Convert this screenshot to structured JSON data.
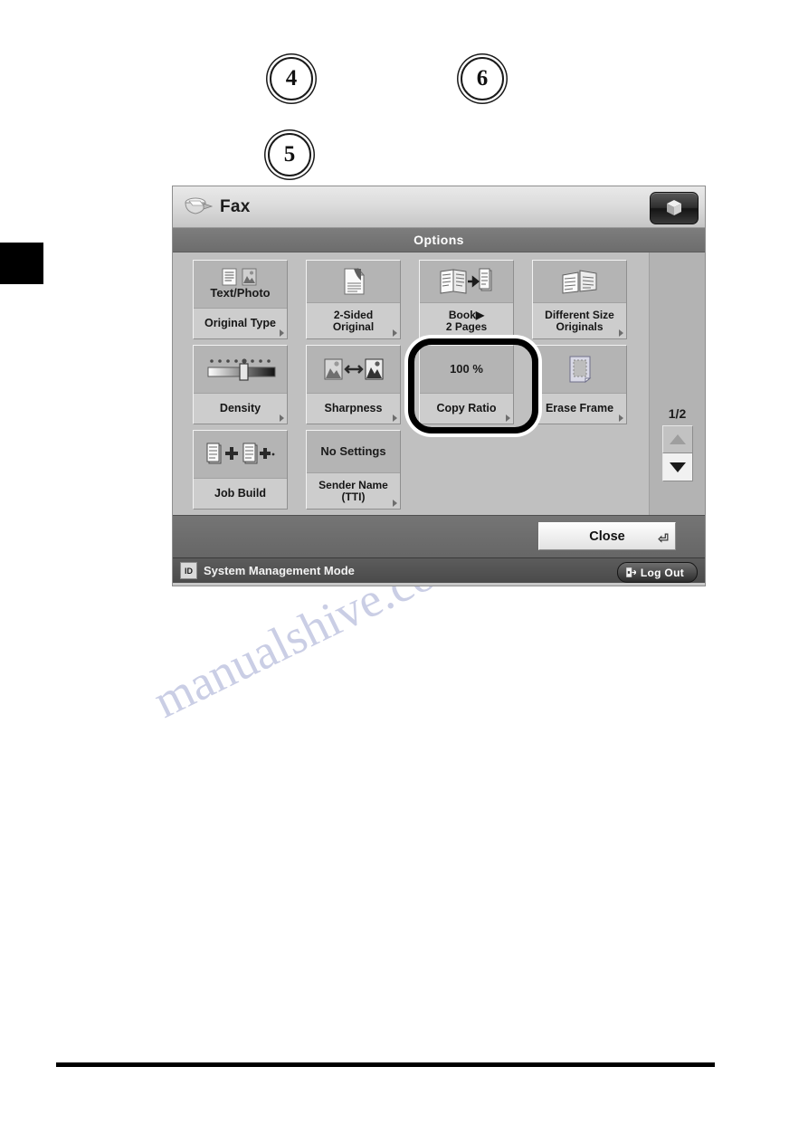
{
  "callouts": [
    {
      "id": "step4",
      "label": "4"
    },
    {
      "id": "step5",
      "label": "5"
    },
    {
      "id": "step6",
      "label": "6"
    }
  ],
  "watermark": {
    "line1": "manualshive.com",
    "line2": "manualshive.com"
  },
  "panel": {
    "titlebar": {
      "title": "Fax",
      "fax_icon": "fax-machine-icon",
      "cube_button_icon": "cube-icon"
    },
    "options_header": "Options",
    "buttons": [
      {
        "name": "original-type",
        "icon": "text-photo-icon",
        "value": "Text/Photo",
        "label": "Original Type",
        "has_arrow": true,
        "value_is_text": true
      },
      {
        "name": "two-sided-original",
        "icon": "folded-page-icon",
        "value": "",
        "label": "2-Sided\nOriginal",
        "has_arrow": true,
        "value_is_text": false
      },
      {
        "name": "book-to-two-pages",
        "icon": "book-to-pages-icon",
        "value": "",
        "label": "Book▶\n2 Pages",
        "has_arrow": false,
        "value_is_text": false
      },
      {
        "name": "different-size-originals",
        "icon": "different-size-icon",
        "value": "",
        "label": "Different Size\nOriginals",
        "has_arrow": true,
        "value_is_text": false
      },
      {
        "name": "density",
        "icon": "density-slider-icon",
        "value": "",
        "label": "Density",
        "has_arrow": true,
        "value_is_text": false
      },
      {
        "name": "sharpness",
        "icon": "sharpness-icon",
        "value": "",
        "label": "Sharpness",
        "has_arrow": true,
        "value_is_text": false
      },
      {
        "name": "copy-ratio",
        "icon": "",
        "value": "100 %",
        "label": "Copy Ratio",
        "has_arrow": true,
        "value_is_text": true,
        "highlighted": true
      },
      {
        "name": "erase-frame",
        "icon": "erase-frame-icon",
        "value": "",
        "label": "Erase Frame",
        "has_arrow": true,
        "value_is_text": false
      },
      {
        "name": "job-build",
        "icon": "job-build-icon",
        "value": "",
        "label": "Job Build",
        "has_arrow": false,
        "value_is_text": false
      },
      {
        "name": "sender-name-tti",
        "icon": "",
        "value": "No Settings",
        "label": "Sender Name\n(TTI)",
        "has_arrow": true,
        "value_is_text": true
      }
    ],
    "scroll": {
      "page_indicator": "1/2",
      "up_icon": "triangle-up-icon",
      "down_icon": "triangle-down-icon",
      "up_enabled": false,
      "down_enabled": true
    },
    "footer": {
      "close_label": "Close",
      "enter_glyph": "⏎"
    },
    "statusbar": {
      "id_chip": "ID",
      "mode_text": "System Management Mode",
      "logout_label": "Log Out",
      "logout_icon": "exit-icon"
    }
  },
  "colors": {
    "panel_bg": "#c0c0c0",
    "title_grad_top": "#e9e9e9",
    "options_bar": "#737373",
    "button_face": "#cdcdcd",
    "button_top": "#b4b4b4",
    "footer": "#6e6e6e",
    "statusbar": "#525252",
    "highlight_ring": "#000000",
    "watermark": "#b9bedd"
  }
}
